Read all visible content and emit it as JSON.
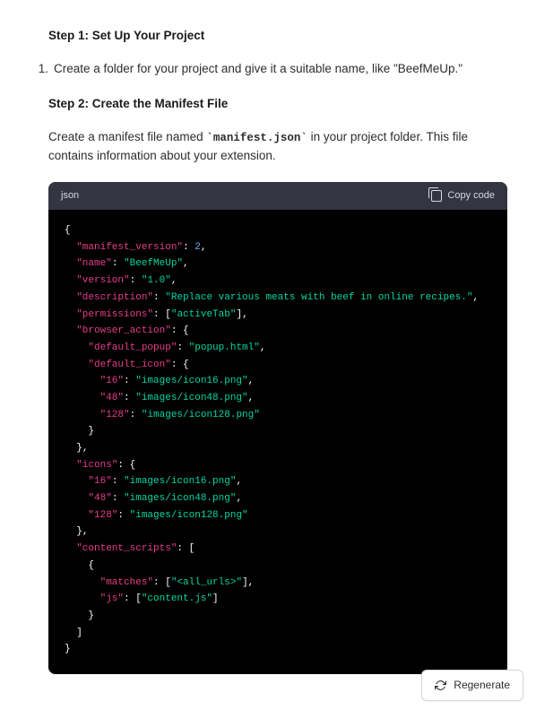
{
  "step1": {
    "title": "Step 1: Set Up Your Project",
    "list_num": "1.",
    "list_text": "Create a folder for your project and give it a suitable name, like \"BeefMeUp.\""
  },
  "step2": {
    "title": "Step 2: Create the Manifest File",
    "para_pre": "Create a manifest file named ",
    "para_code": "`manifest.json`",
    "para_post": " in your project folder. This file contains information about your extension."
  },
  "code_header": {
    "lang": "json",
    "copy_label": "Copy code"
  },
  "regen": {
    "label": "Regenerate"
  },
  "chart_data": {
    "type": "table",
    "title": "manifest.json",
    "data": {
      "manifest_version": 2,
      "name": "BeefMeUp",
      "version": "1.0",
      "description": "Replace various meats with beef in online recipes.",
      "permissions": [
        "activeTab"
      ],
      "browser_action": {
        "default_popup": "popup.html",
        "default_icon": {
          "16": "images/icon16.png",
          "48": "images/icon48.png",
          "128": "images/icon128.png"
        }
      },
      "icons": {
        "16": "images/icon16.png",
        "48": "images/icon48.png",
        "128": "images/icon128.png"
      },
      "content_scripts": [
        {
          "matches": [
            "<all_urls>"
          ],
          "js": [
            "content.js"
          ]
        }
      ]
    }
  }
}
